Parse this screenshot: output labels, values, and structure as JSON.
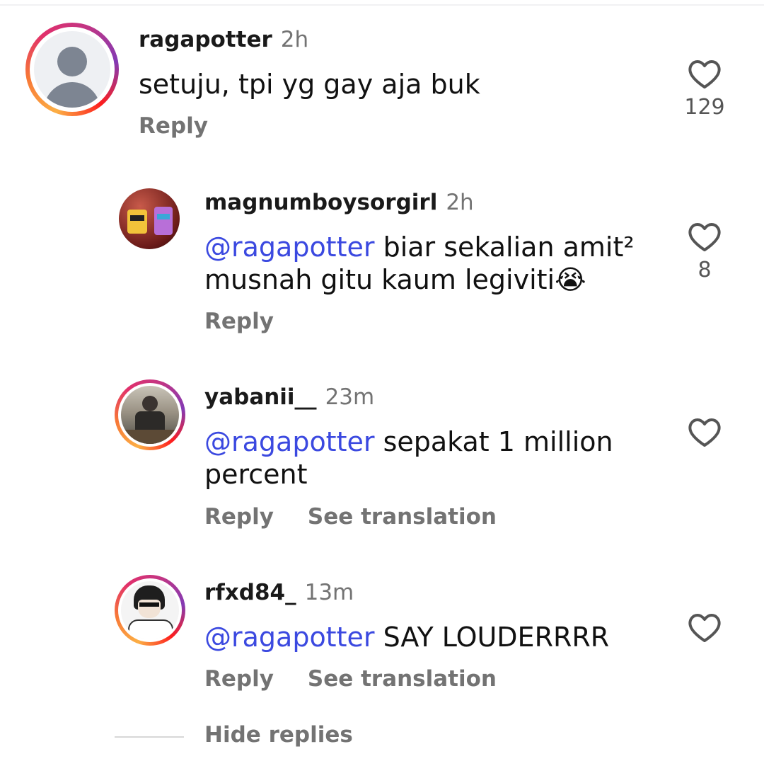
{
  "comments": [
    {
      "username": "ragapotter",
      "time": "2h",
      "text": "setuju, tpi yg gay aja buk",
      "mention": "",
      "reply_label": "Reply",
      "likes": "129"
    },
    {
      "username": "magnumboysorgirl",
      "time": "2h",
      "mention": "@ragapotter",
      "text": "biar sekalian amit² musnah gitu kaum legiviti😭",
      "reply_label": "Reply",
      "likes": "8"
    },
    {
      "username": "yabanii__",
      "time": "23m",
      "mention": "@ragapotter",
      "text": "sepakat 1 million percent",
      "reply_label": "Reply",
      "translate_label": "See translation",
      "likes": ""
    },
    {
      "username": "rfxd84_",
      "time": "13m",
      "mention": "@ragapotter",
      "text": "SAY LOUDERRRR",
      "reply_label": "Reply",
      "translate_label": "See translation",
      "likes": ""
    }
  ],
  "hide_replies_label": "Hide replies",
  "colors": {
    "mention": "#3b49e0",
    "muted": "#737373"
  }
}
